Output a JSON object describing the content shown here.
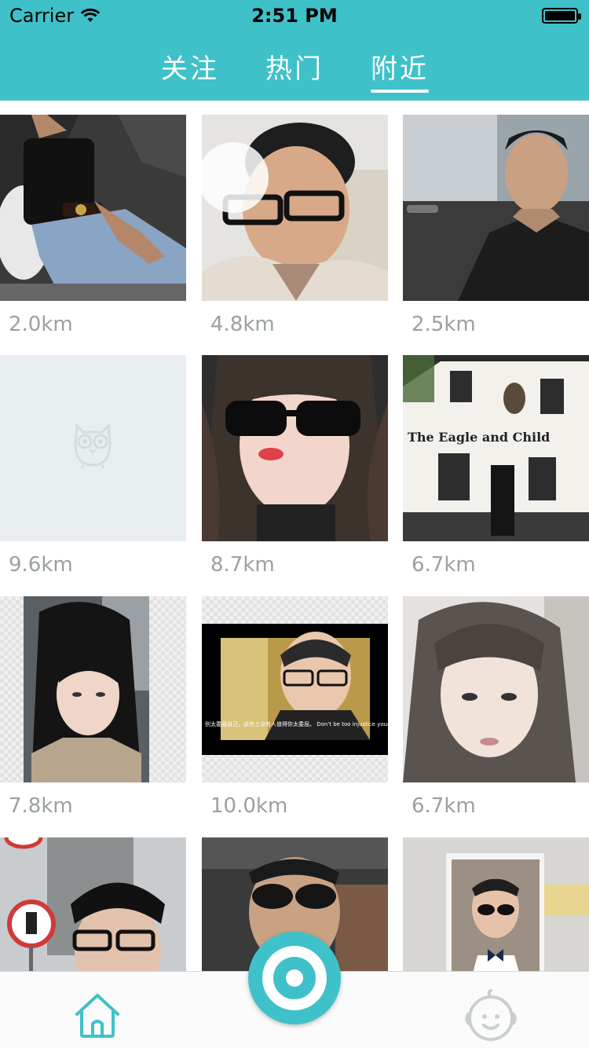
{
  "status": {
    "carrier": "Carrier",
    "time": "2:51 PM"
  },
  "tabs": [
    {
      "label": "关注"
    },
    {
      "label": "热门"
    },
    {
      "label": "附近"
    }
  ],
  "active_tab": "附近",
  "colors": {
    "accent": "#3fc1c9",
    "distance_text": "#9aa0a3",
    "placeholder_bg": "#e8eef0"
  },
  "grid": {
    "items": [
      {
        "distance": "2.0km",
        "photo": "woman-sitting-photo"
      },
      {
        "distance": "4.8km",
        "photo": "man-glasses-selfie"
      },
      {
        "distance": "2.5km",
        "photo": "man-car-selfie"
      },
      {
        "distance": "9.6km",
        "photo": "owl-placeholder"
      },
      {
        "distance": "8.7km",
        "photo": "woman-sunglasses-selfie"
      },
      {
        "distance": "6.7km",
        "photo": "pub-building-photo"
      },
      {
        "distance": "7.8km",
        "photo": "woman-long-hair-photo"
      },
      {
        "distance": "10.0km",
        "photo": "man-video-frame"
      },
      {
        "distance": "6.7km",
        "photo": "woman-sketch-photo"
      },
      {
        "photo": "man-glasses-street-photo"
      },
      {
        "photo": "man-sunglasses-car-photo"
      },
      {
        "photo": "man-bowtie-frame-photo"
      }
    ]
  },
  "caption_text": "别太委屈自己，这世上没有人值得你太委屈。 Don't be too injustice yourself, that few people in the world worth you grieve",
  "sign_text": "The Eagle and Child",
  "tabbar": {
    "home_icon": "home-icon",
    "camera_icon": "camera-icon",
    "profile_icon": "profile-icon"
  }
}
